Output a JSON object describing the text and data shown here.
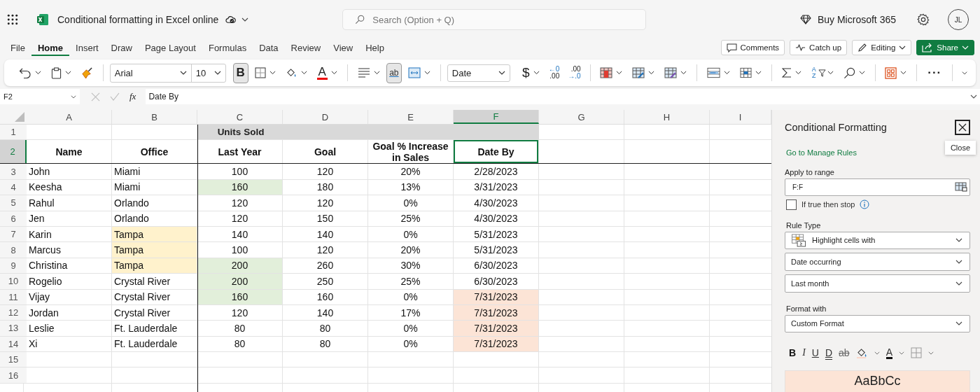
{
  "app_bar": {
    "title": "Conditional formatting in Excel online",
    "search_placeholder": "Search (Option + Q)",
    "buy_label": "Buy Microsoft 365",
    "avatar_initials": "JL"
  },
  "menu_tabs": [
    {
      "label": "File",
      "selected": false
    },
    {
      "label": "Home",
      "selected": true
    },
    {
      "label": "Insert",
      "selected": false
    },
    {
      "label": "Draw",
      "selected": false
    },
    {
      "label": "Page Layout",
      "selected": false
    },
    {
      "label": "Formulas",
      "selected": false
    },
    {
      "label": "Data",
      "selected": false
    },
    {
      "label": "Review",
      "selected": false
    },
    {
      "label": "View",
      "selected": false
    },
    {
      "label": "Help",
      "selected": false
    }
  ],
  "action_buttons": [
    {
      "label": "Comments",
      "kind": "comments"
    },
    {
      "label": "Catch up",
      "kind": "catchup"
    },
    {
      "label": "Editing",
      "kind": "editing"
    },
    {
      "label": "Share",
      "kind": "share"
    }
  ],
  "toolbar": {
    "font_name": "Arial",
    "font_size": "10",
    "bold_label": "B",
    "bold_on": true,
    "font_color_letter": "A",
    "wrap_letters": "ab",
    "wrap_on": true,
    "number_format": "Date",
    "currency_symbol": "$",
    "increase_decimal": {
      "top": "←0",
      "bottom": ".00"
    },
    "decrease_decimal": {
      "top": ".00",
      "bottom": "→.0"
    },
    "sort_letters": "AZ",
    "more_label": "···"
  },
  "formula_bar": {
    "name_box": "F2",
    "fx_label": "fx",
    "content": "Date By"
  },
  "sheet": {
    "columns": [
      {
        "letter": "A",
        "selected": false
      },
      {
        "letter": "B",
        "selected": false
      },
      {
        "letter": "C",
        "selected": false
      },
      {
        "letter": "D",
        "selected": false
      },
      {
        "letter": "E",
        "selected": false
      },
      {
        "letter": "F",
        "selected": true
      },
      {
        "letter": "G",
        "selected": false
      },
      {
        "letter": "H",
        "selected": false
      },
      {
        "letter": "I",
        "selected": false
      }
    ],
    "rows": [
      {
        "number": "1",
        "kind": "group",
        "selected": false,
        "group": {
          "text": "Units Sold",
          "color": "#d9d9d9"
        }
      },
      {
        "number": "2",
        "kind": "header",
        "selected": true,
        "cells": [
          {
            "text": "Name"
          },
          {
            "text": "Office"
          },
          {
            "text": "Last Year"
          },
          {
            "text": "Goal"
          },
          {
            "text": "Goal % Increase in Sales"
          },
          {
            "text": "Date By"
          }
        ]
      },
      {
        "number": "3",
        "kind": "data",
        "selected": false,
        "cells": [
          {
            "text": "John"
          },
          {
            "text": "Miami"
          },
          {
            "text": "100"
          },
          {
            "text": "120"
          },
          {
            "text": "20%"
          },
          {
            "text": "2/28/2023"
          }
        ]
      },
      {
        "number": "4",
        "kind": "data",
        "selected": false,
        "cells": [
          {
            "text": "Keesha"
          },
          {
            "text": "Miami"
          },
          {
            "text": "160",
            "color": "#e2efda"
          },
          {
            "text": "180"
          },
          {
            "text": "13%"
          },
          {
            "text": "3/31/2023"
          }
        ]
      },
      {
        "number": "5",
        "kind": "data",
        "selected": false,
        "cells": [
          {
            "text": "Rahul"
          },
          {
            "text": "Orlando"
          },
          {
            "text": "120"
          },
          {
            "text": "120"
          },
          {
            "text": "0%"
          },
          {
            "text": "4/30/2023"
          }
        ]
      },
      {
        "number": "6",
        "kind": "data",
        "selected": false,
        "cells": [
          {
            "text": "Jen"
          },
          {
            "text": "Orlando"
          },
          {
            "text": "120"
          },
          {
            "text": "150"
          },
          {
            "text": "25%"
          },
          {
            "text": "4/30/2023"
          }
        ]
      },
      {
        "number": "7",
        "kind": "data",
        "selected": false,
        "cells": [
          {
            "text": "Karin"
          },
          {
            "text": "Tampa",
            "color": "#fff2cc"
          },
          {
            "text": "140"
          },
          {
            "text": "140"
          },
          {
            "text": "0%"
          },
          {
            "text": "5/31/2023"
          }
        ]
      },
      {
        "number": "8",
        "kind": "data",
        "selected": false,
        "cells": [
          {
            "text": "Marcus"
          },
          {
            "text": "Tampa",
            "color": "#fff2cc"
          },
          {
            "text": "100"
          },
          {
            "text": "120"
          },
          {
            "text": "20%"
          },
          {
            "text": "5/31/2023"
          }
        ]
      },
      {
        "number": "9",
        "kind": "data",
        "selected": false,
        "cells": [
          {
            "text": "Christina"
          },
          {
            "text": "Tampa",
            "color": "#fff2cc"
          },
          {
            "text": "200",
            "color": "#e2efda"
          },
          {
            "text": "260"
          },
          {
            "text": "30%"
          },
          {
            "text": "6/30/2023"
          }
        ]
      },
      {
        "number": "10",
        "kind": "data",
        "selected": false,
        "cells": [
          {
            "text": "Rogelio"
          },
          {
            "text": "Crystal River"
          },
          {
            "text": "200",
            "color": "#e2efda"
          },
          {
            "text": "250"
          },
          {
            "text": "25%"
          },
          {
            "text": "6/30/2023"
          }
        ]
      },
      {
        "number": "11",
        "kind": "data",
        "selected": false,
        "cells": [
          {
            "text": "Vijay"
          },
          {
            "text": "Crystal River"
          },
          {
            "text": "160",
            "color": "#e2efda"
          },
          {
            "text": "160"
          },
          {
            "text": "0%"
          },
          {
            "text": "7/31/2023",
            "color": "#fce4d6"
          }
        ]
      },
      {
        "number": "12",
        "kind": "data",
        "selected": false,
        "cells": [
          {
            "text": "Jordan"
          },
          {
            "text": "Crystal River"
          },
          {
            "text": "120"
          },
          {
            "text": "140"
          },
          {
            "text": "17%"
          },
          {
            "text": "7/31/2023",
            "color": "#fce4d6"
          }
        ]
      },
      {
        "number": "13",
        "kind": "data",
        "selected": false,
        "cells": [
          {
            "text": "Leslie"
          },
          {
            "text": "Ft. Lauderdale"
          },
          {
            "text": "80"
          },
          {
            "text": "80"
          },
          {
            "text": "0%"
          },
          {
            "text": "7/31/2023",
            "color": "#fce4d6"
          }
        ]
      },
      {
        "number": "14",
        "kind": "data",
        "selected": false,
        "cells": [
          {
            "text": "Xi"
          },
          {
            "text": "Ft. Lauderdale"
          },
          {
            "text": "80"
          },
          {
            "text": "80"
          },
          {
            "text": "0%"
          },
          {
            "text": "7/31/2023",
            "color": "#fce4d6"
          }
        ]
      },
      {
        "number": "15",
        "kind": "data",
        "selected": false
      },
      {
        "number": "16",
        "kind": "data",
        "selected": false
      }
    ]
  },
  "panel": {
    "title": "Conditional Formatting",
    "close_tooltip": "Close",
    "manage_link": "Go to Manage Rules",
    "range_label": "Apply to range",
    "range_value": "F:F",
    "stop_checkbox": {
      "label": "If true then stop",
      "checked": false
    },
    "rule_type_label": "Rule Type",
    "rule_dropdowns": [
      {
        "value": "Highlight cells with",
        "kind": "icon"
      },
      {
        "value": "Date occurring",
        "kind": "plain"
      },
      {
        "value": "Last month",
        "kind": "plain"
      }
    ],
    "format_label": "Format with",
    "format_value": "Custom Format",
    "style_buttons": [
      {
        "label": "B",
        "kind": "bold"
      },
      {
        "label": "I",
        "kind": "italic"
      },
      {
        "label": "U",
        "kind": "underline"
      },
      {
        "label": "D",
        "kind": "double"
      },
      {
        "label": "ab",
        "kind": "strike"
      },
      {
        "label": "A",
        "kind": "fontcolor"
      }
    ],
    "preview": {
      "text": "AaBbCc",
      "color": "#fce4d6"
    }
  }
}
